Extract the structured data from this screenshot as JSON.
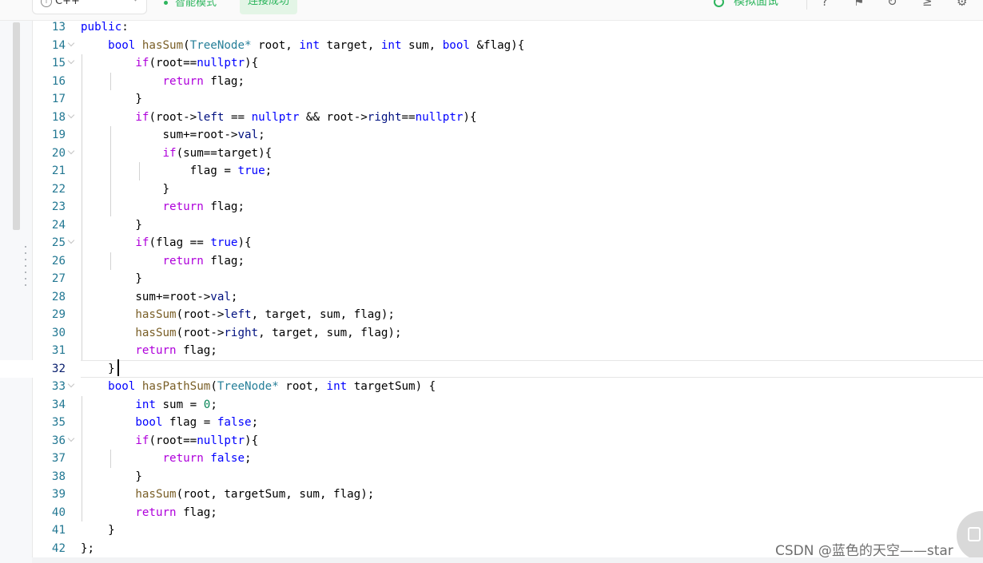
{
  "toolbar": {
    "language": "C++",
    "smart_mode": "智能模式",
    "connection_status": "连接成功",
    "mock_interview": "模拟面试",
    "icons": [
      "info-icon",
      "chevron-down-icon",
      "clock-icon",
      "help-icon",
      "flag-icon",
      "reset-icon",
      "terminal-icon",
      "settings-icon"
    ]
  },
  "editor": {
    "current_line": 32,
    "lines": [
      {
        "n": "13",
        "code": "public:"
      },
      {
        "n": "14",
        "code": "    bool hasSum(TreeNode* root, int target, int sum, bool &flag){"
      },
      {
        "n": "15",
        "code": "        if(root==nullptr){"
      },
      {
        "n": "16",
        "code": "            return flag;"
      },
      {
        "n": "17",
        "code": "        }"
      },
      {
        "n": "18",
        "code": "        if(root->left == nullptr && root->right==nullptr){"
      },
      {
        "n": "19",
        "code": "            sum+=root->val;"
      },
      {
        "n": "20",
        "code": "            if(sum==target){"
      },
      {
        "n": "21",
        "code": "                flag = true;"
      },
      {
        "n": "22",
        "code": "            }"
      },
      {
        "n": "23",
        "code": "            return flag;"
      },
      {
        "n": "24",
        "code": "        }"
      },
      {
        "n": "25",
        "code": "        if(flag == true){"
      },
      {
        "n": "26",
        "code": "            return flag;"
      },
      {
        "n": "27",
        "code": "        }"
      },
      {
        "n": "28",
        "code": "        sum+=root->val;"
      },
      {
        "n": "29",
        "code": "        hasSum(root->left, target, sum, flag);"
      },
      {
        "n": "30",
        "code": "        hasSum(root->right, target, sum, flag);"
      },
      {
        "n": "31",
        "code": "        return flag;"
      },
      {
        "n": "32",
        "code": "    }"
      },
      {
        "n": "33",
        "code": "    bool hasPathSum(TreeNode* root, int targetSum) {"
      },
      {
        "n": "34",
        "code": "        int sum = 0;"
      },
      {
        "n": "35",
        "code": "        bool flag = false;"
      },
      {
        "n": "36",
        "code": "        if(root==nullptr){"
      },
      {
        "n": "37",
        "code": "            return false;"
      },
      {
        "n": "38",
        "code": "        }"
      },
      {
        "n": "39",
        "code": "        hasSum(root, targetSum, sum, flag);"
      },
      {
        "n": "40",
        "code": "        return flag;"
      },
      {
        "n": "41",
        "code": "    }"
      },
      {
        "n": "42",
        "code": "};"
      }
    ]
  },
  "watermark": "CSDN @蓝色的天空——star",
  "colors": {
    "keyword": "#0000ff",
    "function": "#795e26",
    "type": "#267f99",
    "number": "#098658",
    "variable": "#001080",
    "control": "#af00db",
    "line_number": "#237893",
    "accent_green": "#2db55d"
  }
}
